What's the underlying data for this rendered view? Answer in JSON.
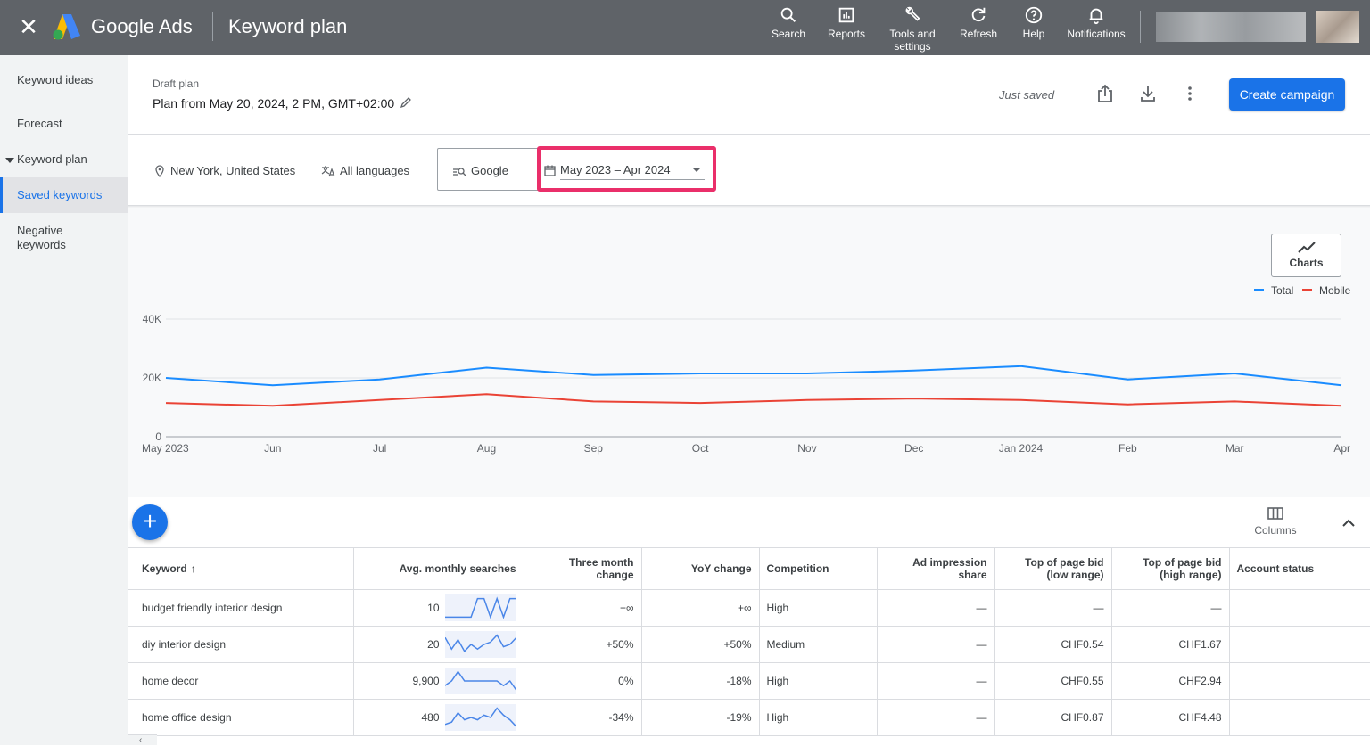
{
  "topbar": {
    "brand": "Google Ads",
    "product": "Keyword plan",
    "buttons": [
      {
        "label": "Search",
        "icon": "search-icon"
      },
      {
        "label": "Reports",
        "icon": "reports-icon"
      },
      {
        "label": "Tools and settings",
        "icon": "wrench-icon"
      },
      {
        "label": "Refresh",
        "icon": "refresh-icon"
      },
      {
        "label": "Help",
        "icon": "help-icon"
      },
      {
        "label": "Notifications",
        "icon": "bell-icon"
      }
    ],
    "colors": {
      "bar": "#5f6368",
      "accent": "#1a73e8"
    }
  },
  "sidebar": {
    "items": [
      {
        "label": "Keyword ideas"
      },
      {
        "label": "Forecast"
      },
      {
        "label": "Keyword plan"
      },
      {
        "label": "Saved keywords",
        "active": true
      },
      {
        "label": "Negative keywords"
      }
    ]
  },
  "header": {
    "draft_label": "Draft plan",
    "plan_title": "Plan from May 20, 2024, 2 PM, GMT+02:00",
    "status": "Just saved",
    "create_label": "Create campaign"
  },
  "filters": {
    "location": "New York, United States",
    "language": "All languages",
    "network": "Google",
    "date_range": "May 2023 – Apr 2024"
  },
  "chart_panel": {
    "charts_label": "Charts",
    "legend": [
      {
        "name": "Total",
        "color": "#1a8cff"
      },
      {
        "name": "Mobile",
        "color": "#ea4335"
      }
    ]
  },
  "chart_data": {
    "type": "line",
    "categories": [
      "May 2023",
      "Jun",
      "Jul",
      "Aug",
      "Sep",
      "Oct",
      "Nov",
      "Dec",
      "Jan 2024",
      "Feb",
      "Mar",
      "Apr"
    ],
    "series": [
      {
        "name": "Total",
        "values": [
          20000,
          17500,
          19500,
          23500,
          21000,
          21500,
          21500,
          22500,
          24000,
          19500,
          21500,
          17500
        ]
      },
      {
        "name": "Mobile",
        "values": [
          11500,
          10500,
          12500,
          14500,
          12000,
          11500,
          12500,
          13000,
          12500,
          11000,
          12000,
          10500
        ]
      }
    ],
    "ylim": [
      0,
      40000
    ],
    "yticks": [
      "0",
      "20K",
      "40K"
    ],
    "grid": true,
    "legend": "top-right"
  },
  "table_toolbar": {
    "columns_label": "Columns"
  },
  "table": {
    "headers": [
      "Keyword",
      "Avg. monthly searches",
      "Three month change",
      "YoY change",
      "Competition",
      "Ad impression share",
      "Top of page bid (low range)",
      "Top of page bid (high range)",
      "Account status"
    ],
    "rows": [
      {
        "keyword": "budget friendly interior design",
        "searches": "10",
        "three_month": "+∞",
        "yoy": "+∞",
        "competition": "High",
        "impression": "—",
        "bid_low": "—",
        "bid_high": "—",
        "status": "",
        "trend": [
          0.1,
          0.1,
          0.1,
          0.1,
          0.1,
          0.9,
          0.9,
          0.1,
          0.9,
          0.1,
          0.9,
          0.9
        ]
      },
      {
        "keyword": "diy interior design",
        "searches": "20",
        "three_month": "+50%",
        "yoy": "+50%",
        "competition": "Medium",
        "impression": "—",
        "bid_low": "CHF0.54",
        "bid_high": "CHF1.67",
        "status": "",
        "trend": [
          0.8,
          0.3,
          0.7,
          0.2,
          0.5,
          0.3,
          0.5,
          0.6,
          0.9,
          0.4,
          0.5,
          0.8
        ]
      },
      {
        "keyword": "home decor",
        "searches": "9,900",
        "three_month": "0%",
        "yoy": "-18%",
        "competition": "High",
        "impression": "—",
        "bid_low": "CHF0.55",
        "bid_high": "CHF2.94",
        "status": "",
        "trend": [
          0.3,
          0.5,
          0.9,
          0.5,
          0.5,
          0.5,
          0.5,
          0.5,
          0.5,
          0.3,
          0.5,
          0.1
        ]
      },
      {
        "keyword": "home office design",
        "searches": "480",
        "three_month": "-34%",
        "yoy": "-19%",
        "competition": "High",
        "impression": "—",
        "bid_low": "CHF0.87",
        "bid_high": "CHF4.48",
        "status": "",
        "trend": [
          0.2,
          0.3,
          0.7,
          0.4,
          0.5,
          0.4,
          0.6,
          0.5,
          0.9,
          0.6,
          0.4,
          0.1
        ]
      }
    ]
  }
}
